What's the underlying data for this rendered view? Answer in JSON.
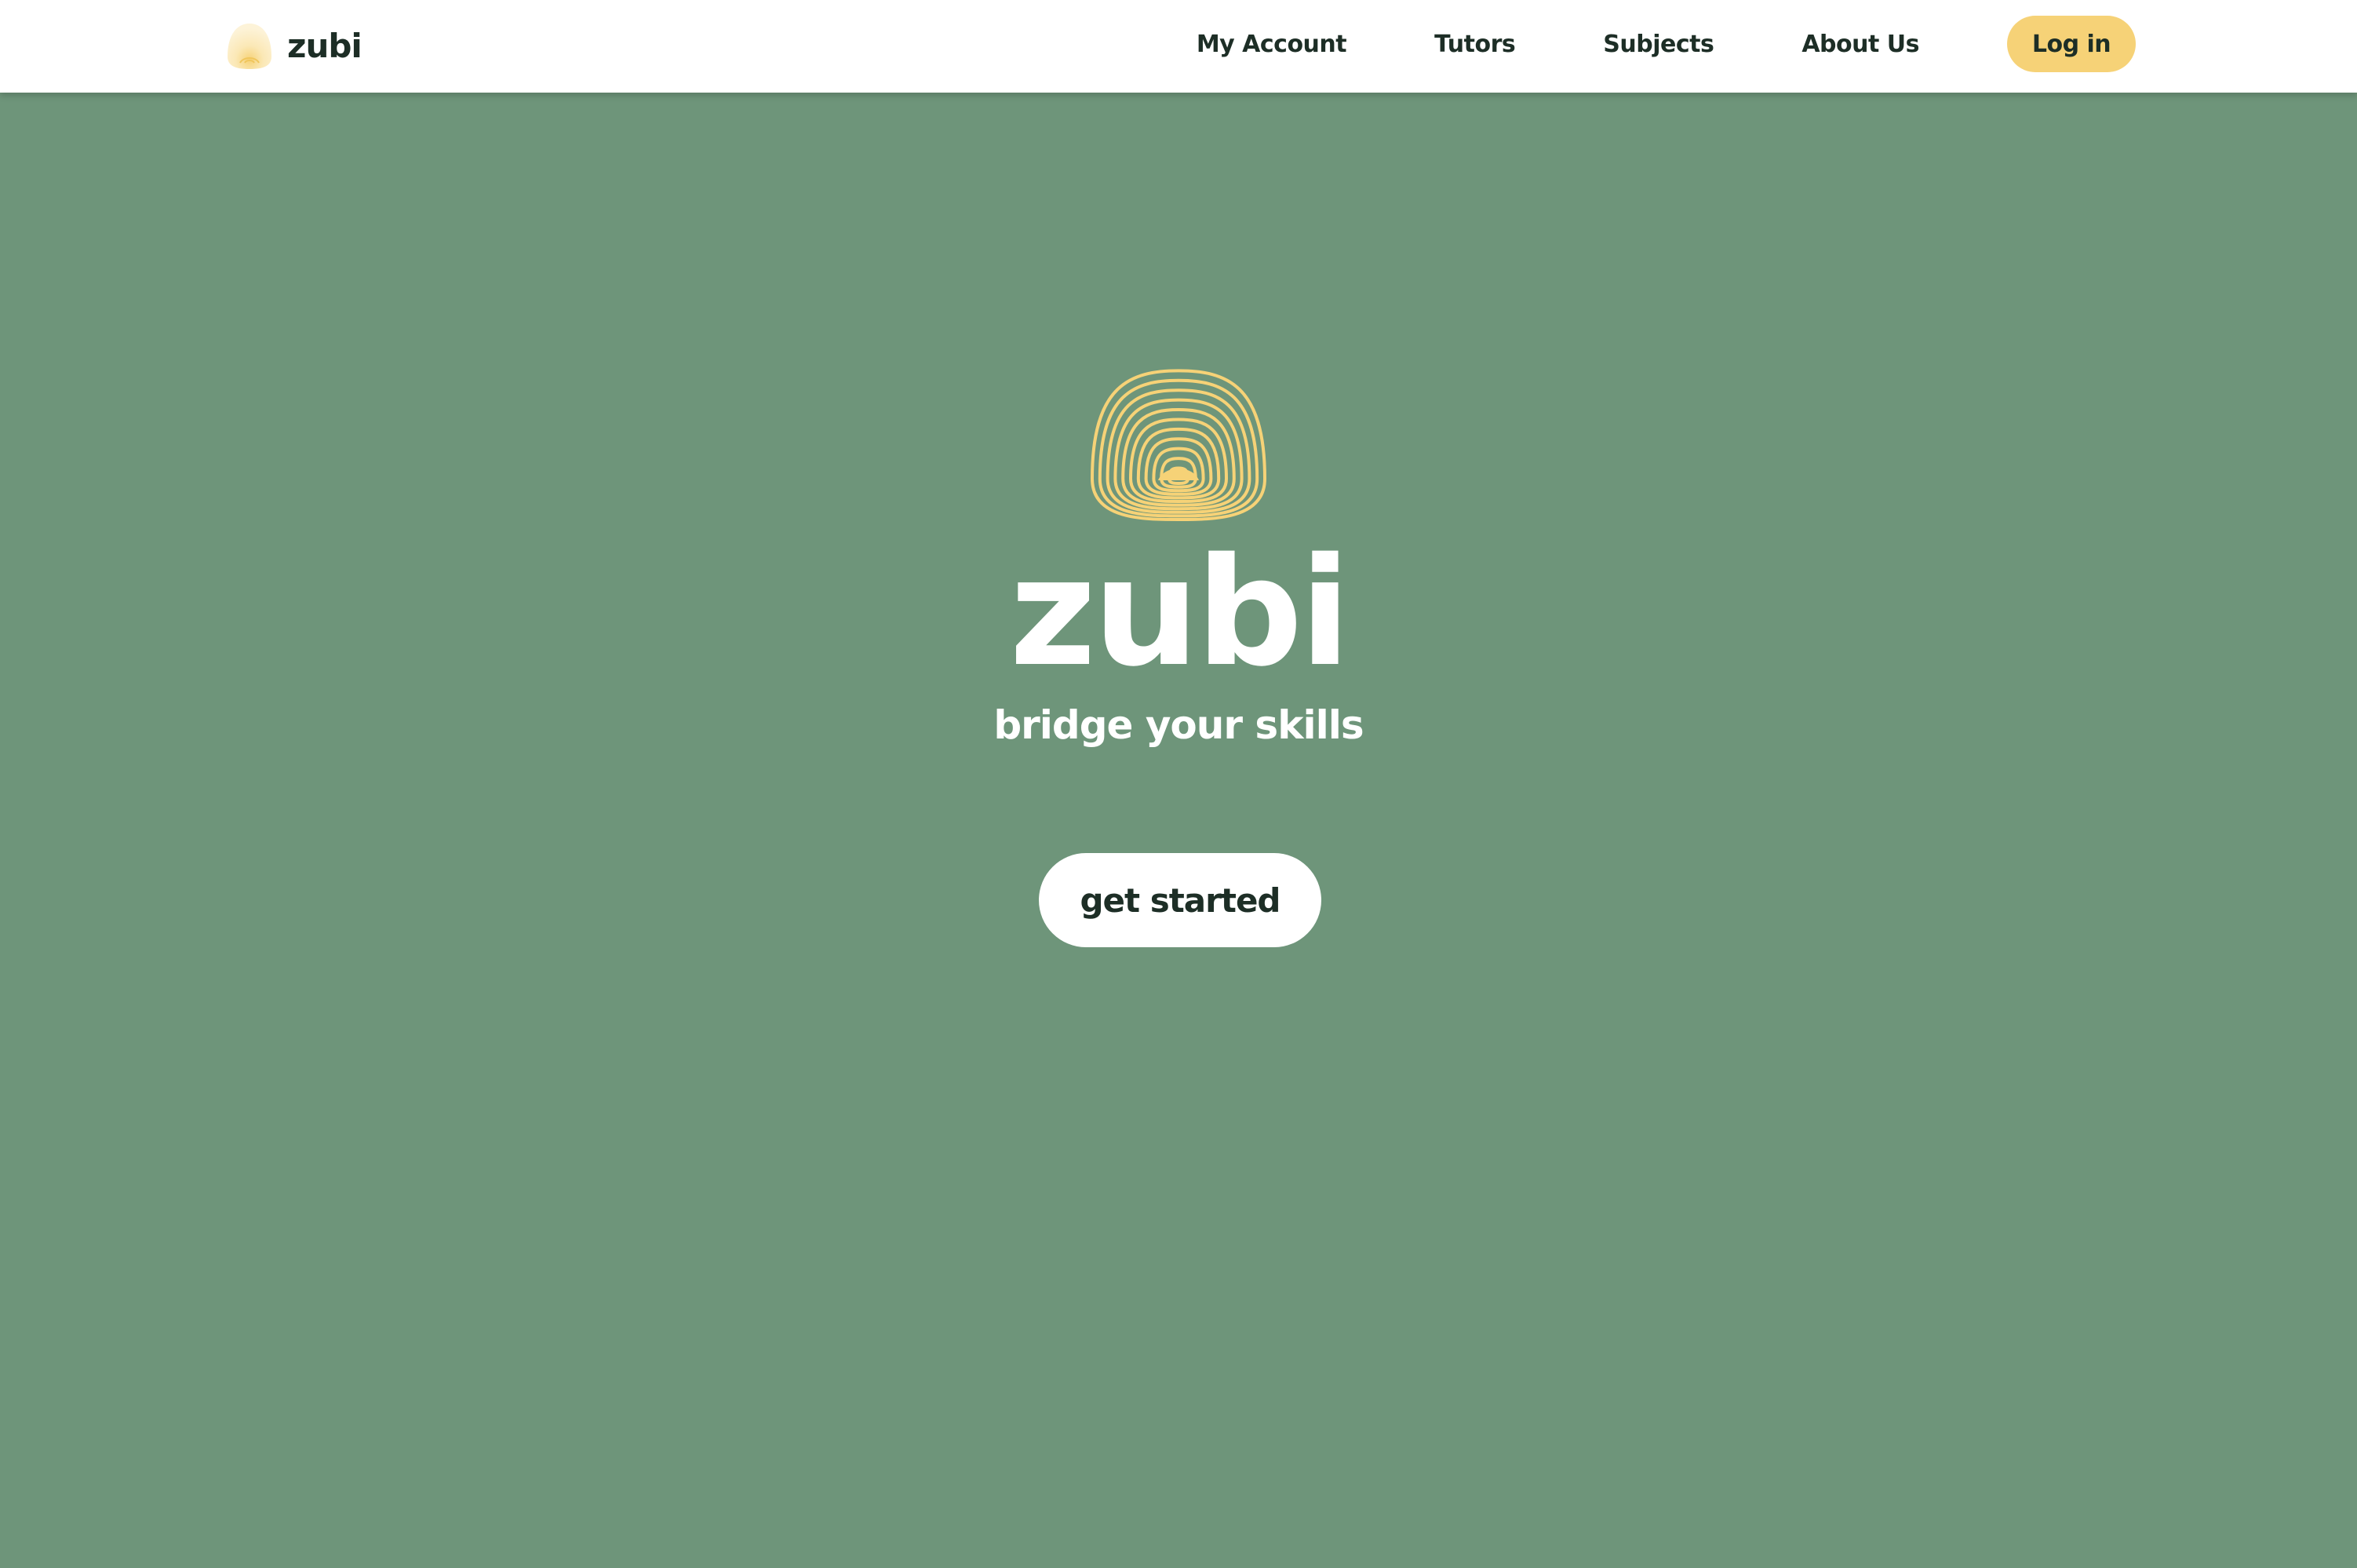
{
  "header": {
    "brand_name": "zubi",
    "brand_icon": "zubi-rainbow-logo-icon",
    "nav": [
      {
        "label": "My Account"
      },
      {
        "label": "Tutors"
      },
      {
        "label": "Subjects"
      },
      {
        "label": "About Us"
      }
    ],
    "login_label": "Log in"
  },
  "hero": {
    "logo_icon": "zubi-rainbow-logo-icon",
    "title": "zubi",
    "tagline": "bridge your skills",
    "cta_label": "get started"
  },
  "colors": {
    "background": "#6e957a",
    "header_background": "#ffffff",
    "accent_yellow": "#f6d277",
    "text_dark": "#1d2e26",
    "text_light": "#ffffff"
  }
}
